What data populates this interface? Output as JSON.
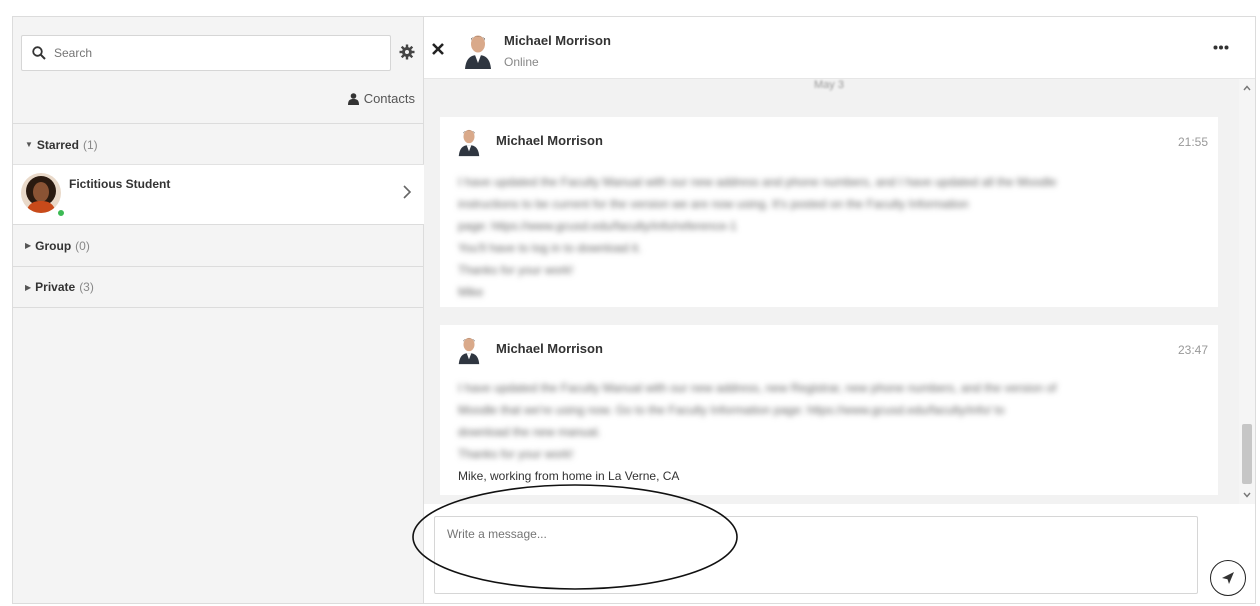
{
  "sidebar": {
    "search_placeholder": "Search",
    "contacts_label": "Contacts",
    "sections": [
      {
        "title": "Starred",
        "count": "(1)"
      },
      {
        "title": "Group",
        "count": "(0)"
      },
      {
        "title": "Private",
        "count": "(3)"
      }
    ],
    "starred_contact": {
      "name": "Fictitious Student",
      "status": "online"
    }
  },
  "chat": {
    "contact_name": "Michael Morrison",
    "contact_status": "Online",
    "day_separator": "May 3",
    "messages": [
      {
        "sender": "Michael Morrison",
        "time": "21:55",
        "lines": [
          "I have updated the Faculty Manual with our new address and phone numbers, and I have updated all the Moodle",
          "instructions to be current for the version we are now using. It's posted on the Faculty Information",
          "page: https://www.gcusd.edu/faculty/info/reference-1",
          "You'll have to log in to download it.",
          "Thanks for your work!",
          "Mike"
        ]
      },
      {
        "sender": "Michael Morrison",
        "time": "23:47",
        "lines": [
          "I have updated the Faculty Manual with our new address, new Registrar, new phone numbers, and the version of",
          "Moodle that we're using now. Go to the Faculty Information page: https://www.gcusd.edu/faculty/info/ to",
          "download the new manual.",
          "Thanks for your work!"
        ],
        "signature": "Mike, working from home in La Verne, CA"
      }
    ],
    "composer_placeholder": "Write a message..."
  },
  "colors": {
    "presence_online": "#3cba54",
    "sidebar_bg": "#f4f4f4",
    "messages_bg": "#f2f2f2"
  },
  "icons": {
    "search": "search-icon",
    "settings": "gear-icon",
    "contacts": "user-icon",
    "close": "close-icon",
    "more": "more-icon",
    "send": "send-icon"
  }
}
